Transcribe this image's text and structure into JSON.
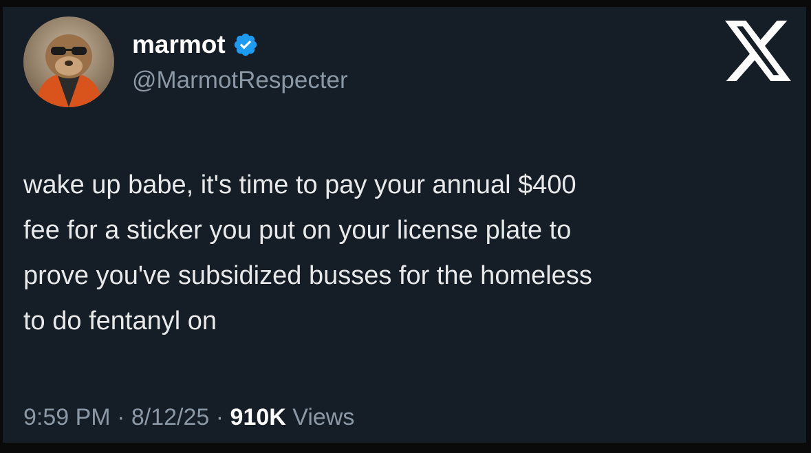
{
  "author": {
    "display_name": "marmot",
    "handle": "@MarmotRespecter",
    "verified": true,
    "avatar": "marmot-avatar"
  },
  "logo": "x-logo-icon",
  "tweet": {
    "text": "wake up babe, it's time to pay your annual $400\nfee for a sticker you put on your license plate to\nprove you've subsidized busses for the homeless\nto do fentanyl on"
  },
  "meta": {
    "time": "9:59 PM",
    "separator": "·",
    "date": "8/12/25",
    "views_count": "910K",
    "views_label": "Views"
  },
  "colors": {
    "background": "#151d26",
    "text": "#e7e9ea",
    "secondary_text": "#8b98a5",
    "verified_badge": "#1d9bf0"
  }
}
